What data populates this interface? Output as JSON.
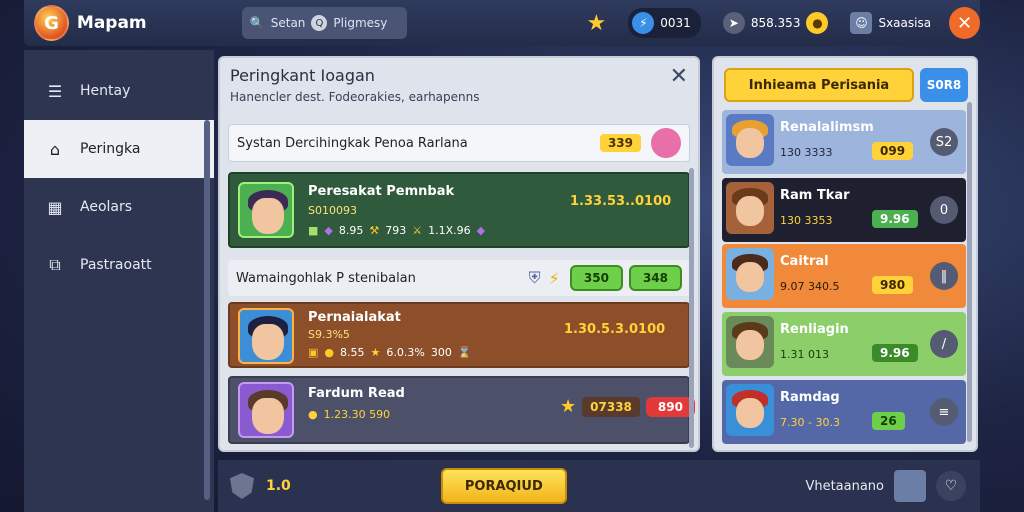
{
  "topbar": {
    "title": "Mapam",
    "search_left": "Setan",
    "search_right": "Pligmesy",
    "currency1": "0031",
    "currency2": "858.353",
    "user": "Sxaasisa"
  },
  "sidebar": {
    "items": [
      {
        "label": "Hentay",
        "icon": "stack-icon"
      },
      {
        "label": "Peringka",
        "icon": "home-icon"
      },
      {
        "label": "Aeolars",
        "icon": "calendar-icon"
      },
      {
        "label": "Pastraoatt",
        "icon": "share-icon"
      }
    ]
  },
  "panel": {
    "title": "Peringkant Ioagan",
    "subtitle": "Hanencler dest. Fodeorakies, earhapenns",
    "header_row": {
      "label": "Systan Dercihingkak Penoa Rarlana",
      "badge": "339"
    },
    "green_row": {
      "name": "Peresakat Pemnbak",
      "sub": "S010093",
      "stats": [
        "8.95",
        "793",
        "1.1X.96"
      ],
      "gold": "1.33.53..0100"
    },
    "plain_row": {
      "label": "Wamaingohlak P stenibalan",
      "btn1": "350",
      "btn2": "348"
    },
    "brown_row": {
      "name": "Pernaialakat",
      "sub": "S9.3%5",
      "stats": [
        "8.55",
        "6.0.3%",
        "300"
      ],
      "gold": "1.30.5.3.0100"
    },
    "dark_row": {
      "name": "Fardum Read",
      "stats": "1.23.30 590",
      "pill": "07338",
      "btn": "890"
    }
  },
  "right_panel": {
    "tab": "Inhieama Perisania",
    "button": "S0R8",
    "cards": [
      {
        "name": "Renalalimsm",
        "stat": "130 3333",
        "value": "099",
        "action": "S2"
      },
      {
        "name": "Ram Tkar",
        "stat": "130 3353",
        "value": "9.96",
        "action": "0"
      },
      {
        "name": "Caitral",
        "stat": "9.07 340.5",
        "value": "980",
        "action": "‖"
      },
      {
        "name": "Renliagin",
        "stat": "1.31 013",
        "value": "9.96",
        "action": "/"
      },
      {
        "name": "Ramdag",
        "stat": "7.30 - 30.3",
        "value": "26",
        "action": "≡"
      }
    ]
  },
  "bottom": {
    "value": "1.0",
    "main_button": "PORAQIUD",
    "username": "Vhetaanano"
  }
}
